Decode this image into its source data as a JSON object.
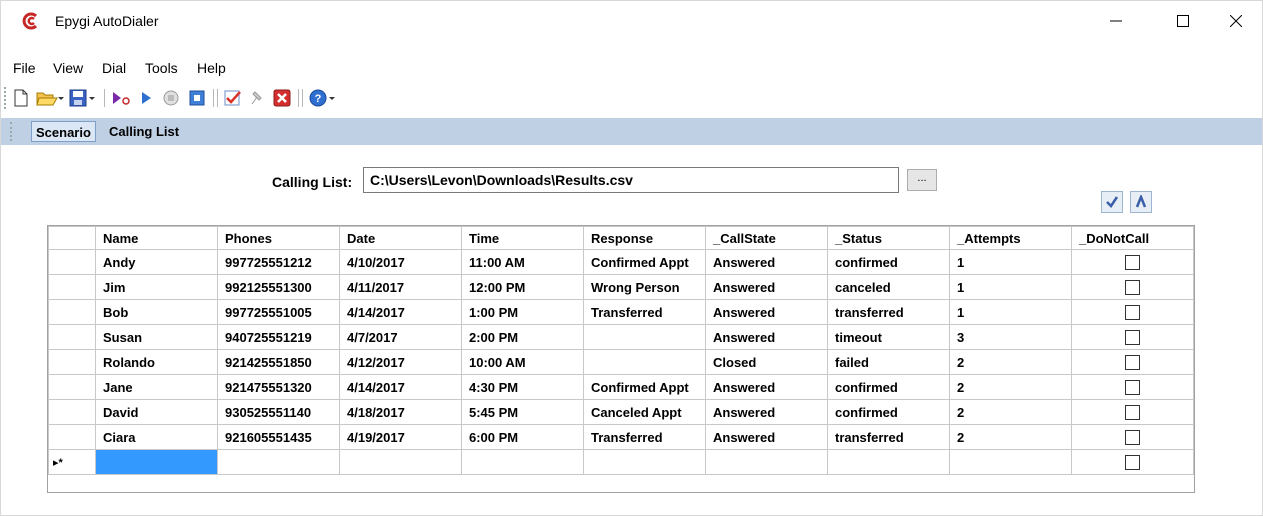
{
  "window": {
    "title": "Epygi AutoDialer"
  },
  "menu": [
    "File",
    "View",
    "Dial",
    "Tools",
    "Help"
  ],
  "toolbar_icons": [
    "new-icon",
    "open-icon",
    "save-icon",
    "dial-icon",
    "play-icon",
    "stop-icon",
    "pause-icon",
    "check-icon",
    "pin-icon",
    "delete-icon",
    "help-icon"
  ],
  "tabs": [
    {
      "label": "Scenario",
      "active": true
    },
    {
      "label": "Calling List",
      "active": false
    }
  ],
  "calling_list": {
    "label": "Calling List:",
    "path": "C:\\Users\\Levon\\Downloads\\Results.csv",
    "browse_label": "..."
  },
  "grid": {
    "columns": [
      "Name",
      "Phones",
      "Date",
      "Time",
      "Response",
      "_CallState",
      "_Status",
      "_Attempts",
      "_DoNotCall"
    ],
    "rows": [
      [
        "Andy",
        "997725551212",
        "4/10/2017",
        "11:00 AM",
        "Confirmed Appt",
        "Answered",
        "confirmed",
        "1"
      ],
      [
        "Jim",
        "992125551300",
        "4/11/2017",
        "12:00 PM",
        "Wrong Person",
        "Answered",
        "canceled",
        "1"
      ],
      [
        "Bob",
        "997725551005",
        "4/14/2017",
        "1:00 PM",
        "Transferred",
        "Answered",
        "transferred",
        "1"
      ],
      [
        "Susan",
        "940725551219",
        "4/7/2017",
        "2:00 PM",
        "",
        "Answered",
        "timeout",
        "3"
      ],
      [
        "Rolando",
        "921425551850",
        "4/12/2017",
        "10:00 AM",
        "",
        "Closed",
        "failed",
        "2"
      ],
      [
        "Jane",
        "921475551320",
        "4/14/2017",
        "4:30 PM",
        "Confirmed Appt",
        "Answered",
        "confirmed",
        "2"
      ],
      [
        "David",
        "930525551140",
        "4/18/2017",
        "5:45 PM",
        "Canceled Appt",
        "Answered",
        "confirmed",
        "2"
      ],
      [
        "Ciara",
        "921605551435",
        "4/19/2017",
        "6:00 PM",
        "Transferred",
        "Answered",
        "transferred",
        "2"
      ]
    ],
    "new_row_marker": "▸*"
  },
  "colors": {
    "tabstrip": "#bfd0e4",
    "selection": "#3399ff"
  }
}
